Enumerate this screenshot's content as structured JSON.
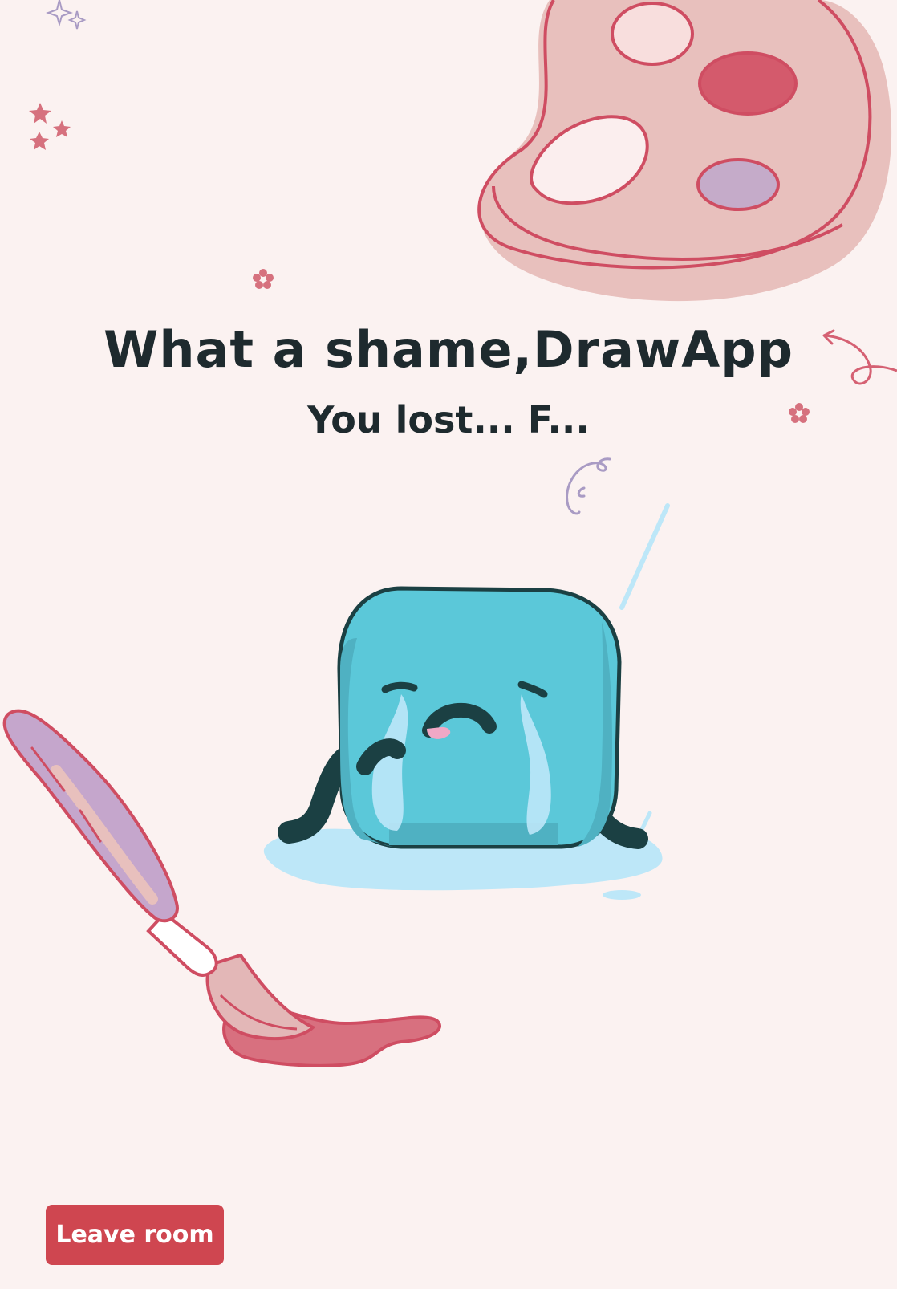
{
  "result": {
    "headline": "What a shame,DrawApp",
    "subline": "You lost... F..."
  },
  "actions": {
    "leave_label": "Leave room"
  },
  "colors": {
    "background": "#fbf2f1",
    "accent": "#cf4650",
    "text": "#1e2a2e",
    "character": "#5bc8d9"
  },
  "illustrations": {
    "palette": "paint-palette-icon",
    "brush": "paintbrush-icon",
    "character": "crying-cube-character",
    "decorations": [
      "sparkle-icon",
      "star-icon",
      "flower-icon",
      "arrow-squiggle-icon",
      "swirl-icon"
    ]
  }
}
